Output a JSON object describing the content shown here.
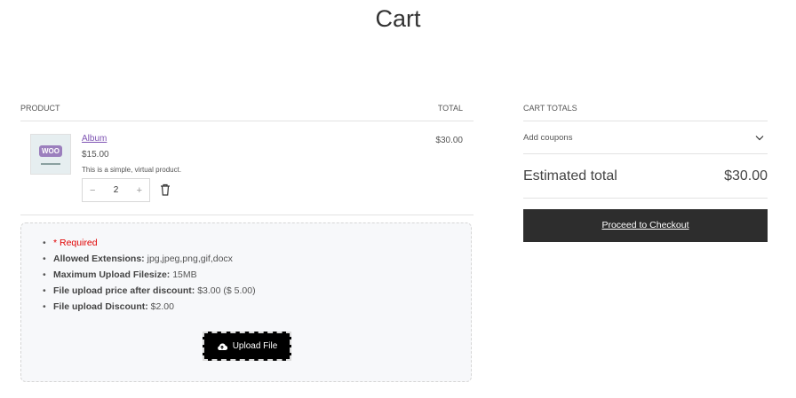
{
  "page": {
    "title": "Cart"
  },
  "table": {
    "product_header": "PRODUCT",
    "total_header": "TOTAL"
  },
  "item": {
    "name": "Album",
    "price": "$15.00",
    "description": "This is a simple, virtual product.",
    "quantity": "2",
    "minus": "−",
    "plus": "+",
    "total": "$30.00",
    "thumb_text": "WOO"
  },
  "upload": {
    "required": "* Required",
    "ext_label": "Allowed Extensions:",
    "ext_value": " jpg,jpeg,png,gif,docx",
    "size_label": "Maximum Upload Filesize:",
    "size_value": " 15MB",
    "price_label": "File upload price after discount:",
    "price_value": " $3.00 ($ 5.00)",
    "discount_label": "File upload Discount:",
    "discount_value": " $2.00",
    "button_label": "Upload File"
  },
  "totals": {
    "header": "CART TOTALS",
    "coupons_label": "Add coupons",
    "estimated_label": "Estimated total",
    "estimated_value": "$30.00",
    "checkout_label": "Proceed to Checkout"
  },
  "colors": {
    "accent": "#7f54b3",
    "required": "#e00000",
    "checkout_bg": "#2d2d2d"
  }
}
